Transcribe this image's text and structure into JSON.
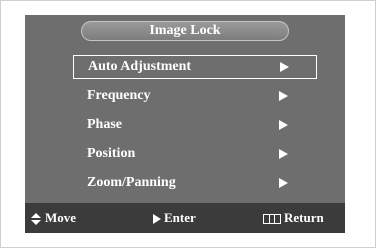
{
  "title": "Image Lock",
  "menu": {
    "items": [
      {
        "label": "Auto Adjustment",
        "selected": true
      },
      {
        "label": "Frequency",
        "selected": false
      },
      {
        "label": "Phase",
        "selected": false
      },
      {
        "label": "Position",
        "selected": false
      },
      {
        "label": "Zoom/Panning",
        "selected": false
      }
    ]
  },
  "footer": {
    "move": "Move",
    "enter": "Enter",
    "return": "Return"
  },
  "colors": {
    "panel": "#6e6e6e",
    "footer": "#3b3b3b",
    "text": "#ffffff"
  },
  "icons": {
    "move": "up-down-arrows-icon",
    "enter": "right-triangle-icon",
    "return": "menu-icon",
    "submenu": "right-triangle-icon"
  }
}
